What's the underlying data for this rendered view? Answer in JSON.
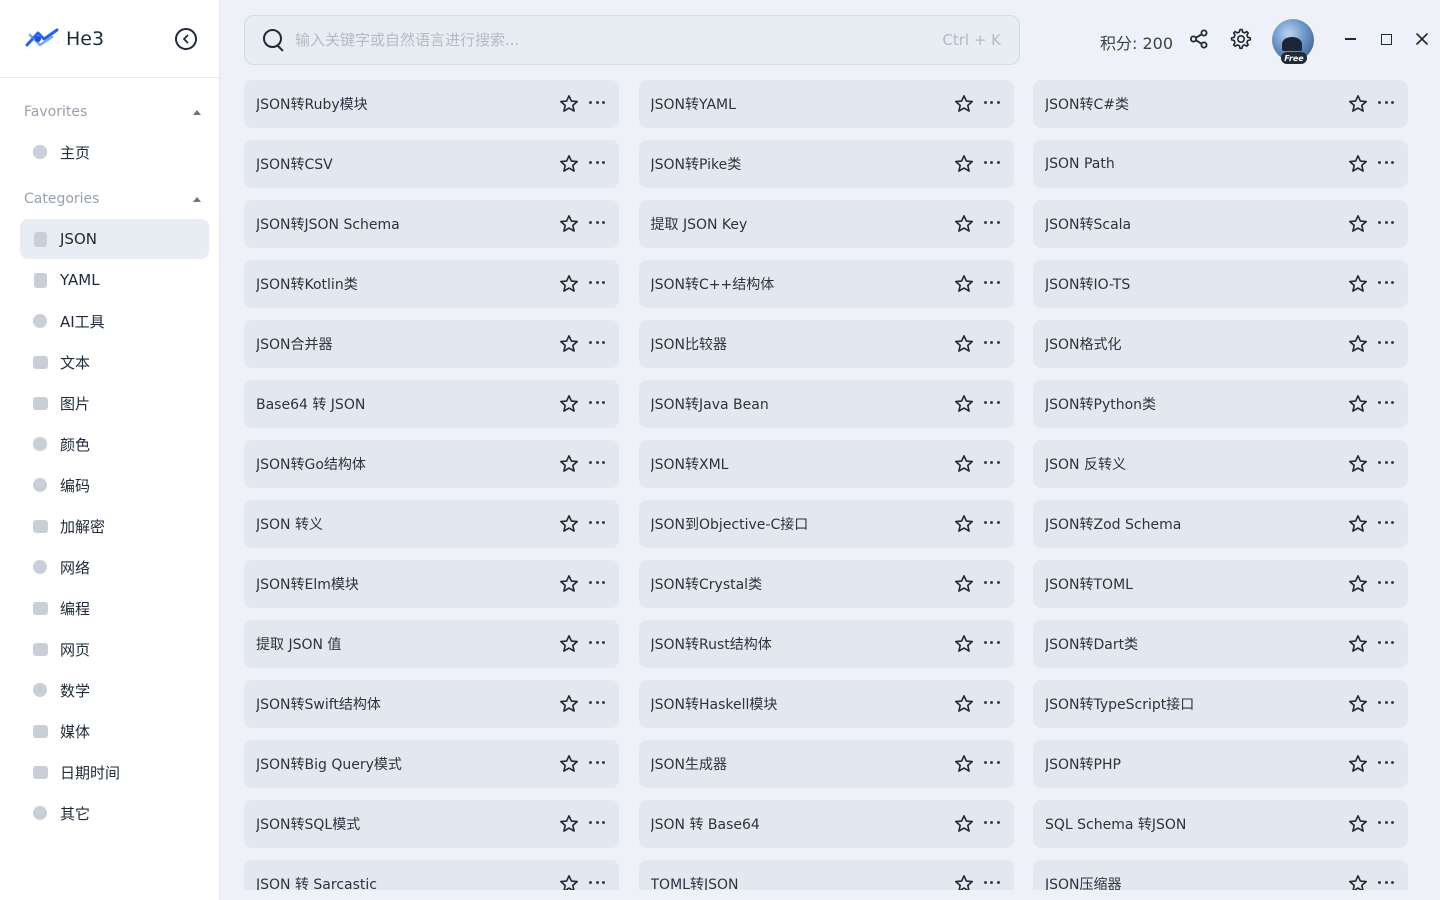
{
  "app": {
    "name": "He3"
  },
  "sidebar": {
    "favorites_label": "Favorites",
    "favorites": [
      {
        "label": "主页",
        "icon": "home-icon"
      }
    ],
    "categories_label": "Categories",
    "categories": [
      {
        "label": "JSON",
        "icon": "file-json-icon",
        "active": true
      },
      {
        "label": "YAML",
        "icon": "file-yaml-icon"
      },
      {
        "label": "AI工具",
        "icon": "ai-scan-icon"
      },
      {
        "label": "文本",
        "icon": "text-icon"
      },
      {
        "label": "图片",
        "icon": "image-icon"
      },
      {
        "label": "颜色",
        "icon": "palette-icon"
      },
      {
        "label": "编码",
        "icon": "encode-icon"
      },
      {
        "label": "加解密",
        "icon": "crypto-icon"
      },
      {
        "label": "网络",
        "icon": "globe-icon"
      },
      {
        "label": "编程",
        "icon": "code-icon"
      },
      {
        "label": "网页",
        "icon": "browser-icon"
      },
      {
        "label": "数学",
        "icon": "chart-pie-icon"
      },
      {
        "label": "媒体",
        "icon": "media-icon"
      },
      {
        "label": "日期时间",
        "icon": "calendar-icon"
      },
      {
        "label": "其它",
        "icon": "bulb-icon"
      }
    ]
  },
  "search": {
    "placeholder": "输入关键字或自然语言进行搜索...",
    "shortcut": "Ctrl + K"
  },
  "header": {
    "score": "积分: 200",
    "badge": "Free"
  },
  "tools": [
    "JSON转Ruby模块",
    "JSON转YAML",
    "JSON转C#类",
    "JSON转CSV",
    "JSON转Pike类",
    "JSON Path",
    "JSON转JSON Schema",
    "提取 JSON Key",
    "JSON转Scala",
    "JSON转Kotlin类",
    "JSON转C++结构体",
    "JSON转IO-TS",
    "JSON合并器",
    "JSON比较器",
    "JSON格式化",
    "Base64 转 JSON",
    "JSON转Java Bean",
    "JSON转Python类",
    "JSON转Go结构体",
    "JSON转XML",
    "JSON 反转义",
    "JSON 转义",
    "JSON到Objective-C接口",
    "JSON转Zod Schema",
    "JSON转Elm模块",
    "JSON转Crystal类",
    "JSON转TOML",
    "提取 JSON 值",
    "JSON转Rust结构体",
    "JSON转Dart类",
    "JSON转Swift结构体",
    "JSON转Haskell模块",
    "JSON转TypeScript接口",
    "JSON转Big Query模式",
    "JSON生成器",
    "JSON转PHP",
    "JSON转SQL模式",
    "JSON 转 Base64",
    "SQL Schema 转JSON",
    "JSON 转 Sarcastic",
    "TOML转JSON",
    "JSON压缩器"
  ]
}
